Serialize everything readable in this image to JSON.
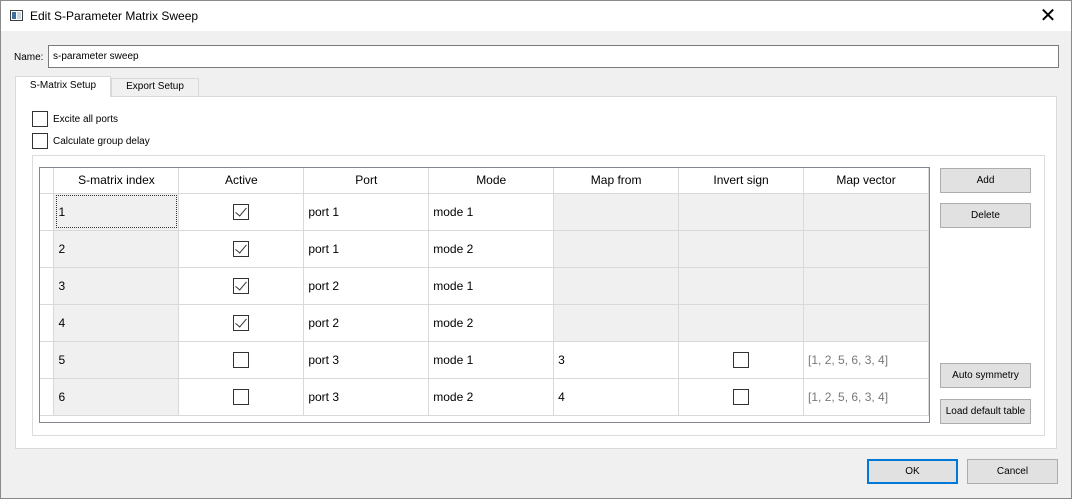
{
  "window": {
    "title": "Edit S-Parameter Matrix Sweep",
    "close_glyph": "✕"
  },
  "name_field": {
    "label": "Name:",
    "value": "s-parameter sweep"
  },
  "tabs": [
    {
      "label": "S-Matrix Setup",
      "active": true
    },
    {
      "label": "Export Setup",
      "active": false
    }
  ],
  "options": {
    "excite_all_ports": {
      "label": "Excite all ports",
      "checked": false
    },
    "calculate_group_delay": {
      "label": "Calculate group delay",
      "checked": false
    }
  },
  "table": {
    "headers": [
      "S-matrix index",
      "Active",
      "Port",
      "Mode",
      "Map from",
      "Invert sign",
      "Map vector"
    ],
    "rows": [
      {
        "index": "1",
        "active": true,
        "port": "port 1",
        "mode": "mode 1",
        "map_from": "",
        "invert_sign": null,
        "map_vector": ""
      },
      {
        "index": "2",
        "active": true,
        "port": "port 1",
        "mode": "mode 2",
        "map_from": "",
        "invert_sign": null,
        "map_vector": ""
      },
      {
        "index": "3",
        "active": true,
        "port": "port 2",
        "mode": "mode 1",
        "map_from": "",
        "invert_sign": null,
        "map_vector": ""
      },
      {
        "index": "4",
        "active": true,
        "port": "port 2",
        "mode": "mode 2",
        "map_from": "",
        "invert_sign": null,
        "map_vector": ""
      },
      {
        "index": "5",
        "active": false,
        "port": "port 3",
        "mode": "mode 1",
        "map_from": "3",
        "invert_sign": false,
        "map_vector": "[1, 2, 5, 6, 3, 4]"
      },
      {
        "index": "6",
        "active": false,
        "port": "port 3",
        "mode": "mode 2",
        "map_from": "4",
        "invert_sign": false,
        "map_vector": "[1, 2, 5, 6, 3, 4]"
      }
    ]
  },
  "side_buttons": {
    "add": "Add",
    "delete": "Delete",
    "auto_symmetry": "Auto symmetry",
    "load_default_table": "Load default table"
  },
  "dialog_buttons": {
    "ok": "OK",
    "cancel": "Cancel"
  },
  "colors": {
    "accent": "#0078d7",
    "disabled_cell": "#f0f0f0",
    "map_vector_text": "#787878"
  }
}
